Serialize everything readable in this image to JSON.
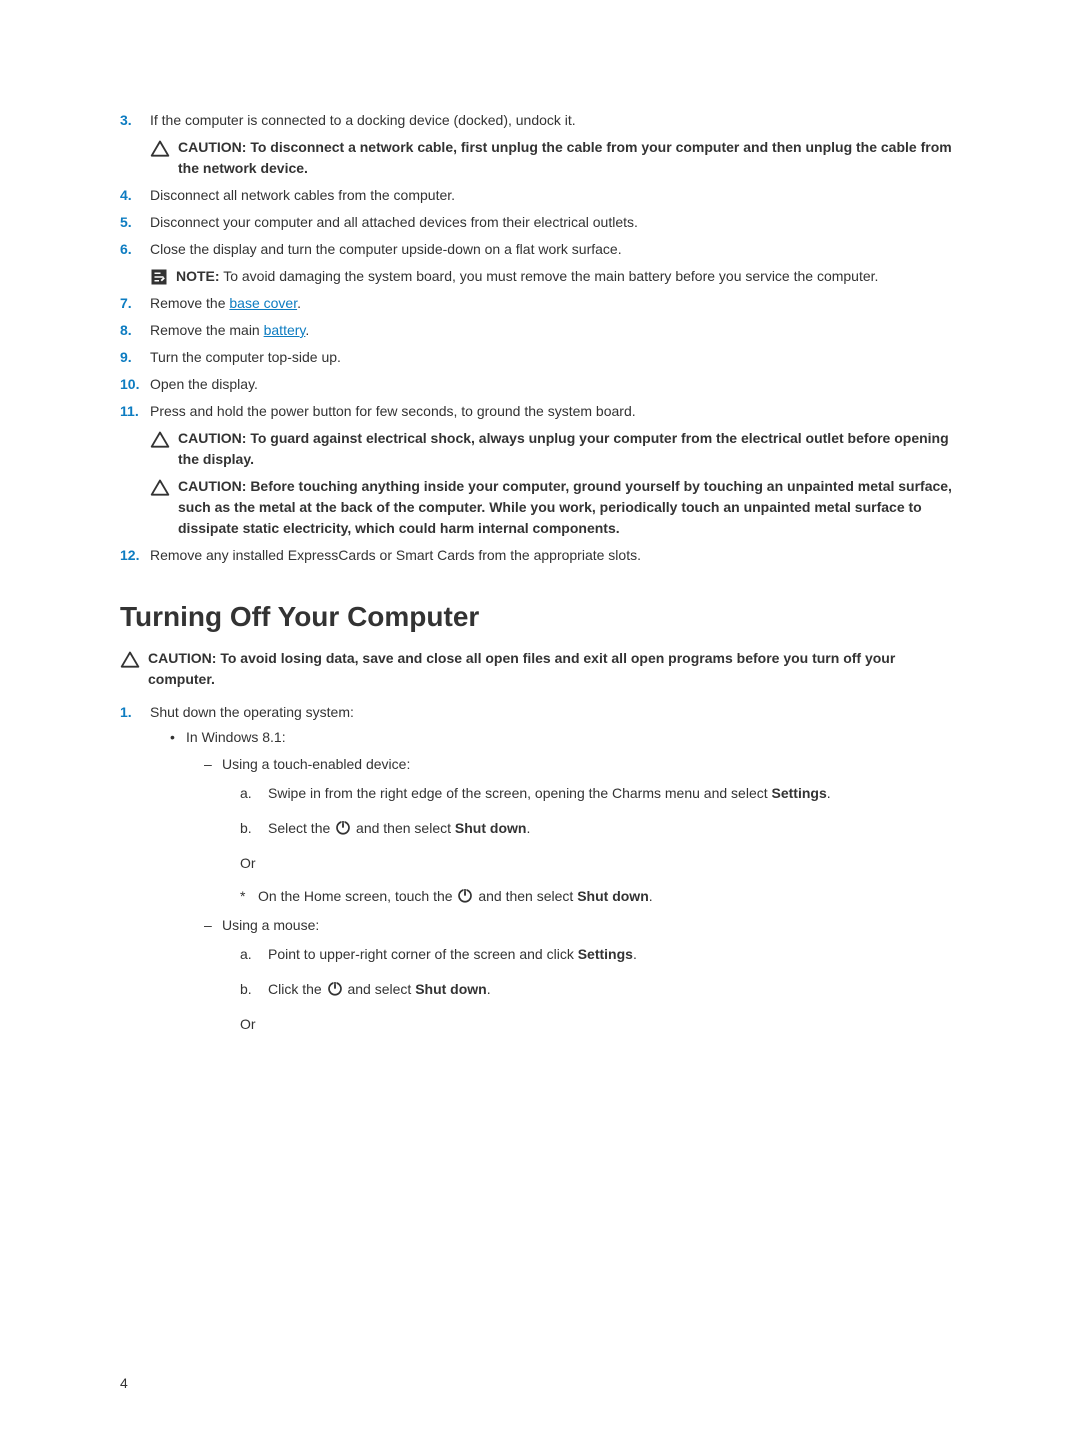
{
  "steps": {
    "s3": "If the computer is connected to a docking device (docked), undock it.",
    "s3_caution": "CAUTION: To disconnect a network cable, first unplug the cable from your computer and then unplug the cable from the network device.",
    "s4": "Disconnect all network cables from the computer.",
    "s5": "Disconnect your computer and all attached devices from their electrical outlets.",
    "s6": "Close the display and turn the computer upside-down on a flat work surface.",
    "s6_note_label": "NOTE:",
    "s6_note": "To avoid damaging the system board, you must remove the main battery before you service the computer.",
    "s7_pre": "Remove the ",
    "s7_link": "base cover",
    "s7_post": ".",
    "s8_pre": "Remove the main ",
    "s8_link": "battery",
    "s8_post": ".",
    "s9": "Turn the computer top-side up.",
    "s10": "Open the display.",
    "s11": "Press and hold the power button for few seconds, to ground the system board.",
    "s11_caution1": "CAUTION: To guard against electrical shock, always unplug your computer from the electrical outlet before opening the display.",
    "s11_caution2": "CAUTION: Before touching anything inside your computer, ground yourself by touching an unpainted metal surface, such as the metal at the back of the computer. While you work, periodically touch an unpainted metal surface to dissipate static electricity, which could harm internal components.",
    "s12": "Remove any installed ExpressCards or Smart Cards from the appropriate slots."
  },
  "heading": "Turning Off Your Computer",
  "heading_caution": "CAUTION: To avoid losing data, save and close all open files and exit all open programs before you turn off your computer.",
  "shutdown": {
    "s1": "Shut down the operating system:",
    "win": "In Windows 8.1:",
    "touch_label": "Using a touch-enabled device:",
    "touch_a": "Swipe in from the right edge of the screen, opening the Charms menu and select ",
    "settings": "Settings",
    "touch_b_pre": "Select the ",
    "touch_b_mid": " and then select ",
    "shut_down": "Shut down",
    "or": "Or",
    "touch_star_pre": "On the Home screen, touch the ",
    "touch_star_mid": " and then select ",
    "mouse_label": "Using a mouse:",
    "mouse_a": "Point to upper-right corner of the screen and click ",
    "mouse_b_pre": "Click the ",
    "mouse_b_mid": " and select "
  },
  "page_num": "4"
}
